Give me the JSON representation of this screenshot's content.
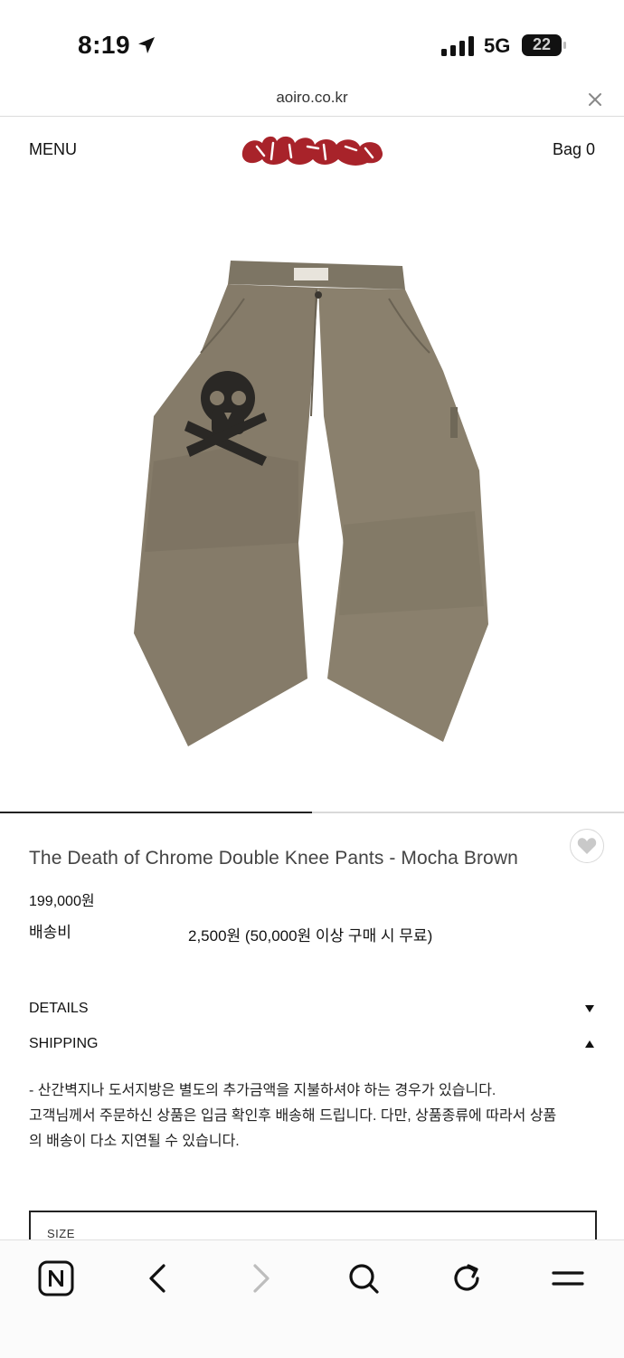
{
  "status_bar": {
    "time": "8:19",
    "network": "5G",
    "battery": "22"
  },
  "browser": {
    "url": "aoiro.co.kr"
  },
  "header": {
    "menu_label": "MENU",
    "bag_label": "Bag 0",
    "logo_color": "#a8232a"
  },
  "product": {
    "title": "The Death of Chrome Double Knee Pants - Mocha Brown",
    "price": "199,000원",
    "shipping_label": "배송비",
    "shipping_value": "2,500원 (50,000원 이상 구매 시 무료)",
    "image_progress": 0.5
  },
  "accordion": {
    "details_label": "DETAILS",
    "shipping_label": "SHIPPING",
    "shipping_lines": [
      "- 산간벽지나 도서지방은 별도의 추가금액을 지불하셔야 하는 경우가 있습니다.",
      "고객님께서 주문하신 상품은 입금 확인후 배송해 드립니다. 다만, 상품종류에 따라서 상품",
      "의 배송이 다소 지연될 수 있습니다."
    ]
  },
  "options": {
    "size_label": "SIZE"
  },
  "toolbar": {
    "icons": [
      "naver-icon",
      "back-icon",
      "forward-icon",
      "search-icon",
      "reload-icon",
      "menu-icon"
    ]
  }
}
